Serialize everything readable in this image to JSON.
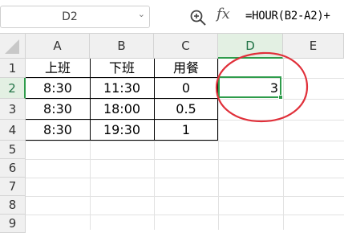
{
  "namebox": {
    "value": "D2",
    "arrow": "⌄"
  },
  "toolbar": {
    "zoom_icon": "zoom-magnifier-icon",
    "fx_label": "fx"
  },
  "formula": {
    "value": "=HOUR(B2-A2)+"
  },
  "columns": [
    "A",
    "B",
    "C",
    "D",
    "E"
  ],
  "rows": [
    "1",
    "2",
    "3",
    "4",
    "5",
    "6",
    "7",
    "8",
    "9"
  ],
  "table": {
    "headers": [
      "上班",
      "下班",
      "用餐"
    ],
    "r2": [
      "8:30",
      "11:30",
      "0"
    ],
    "r3": [
      "8:30",
      "18:00",
      "0.5"
    ],
    "r4": [
      "8:30",
      "19:30",
      "1"
    ]
  },
  "result": {
    "d2": "3"
  },
  "colors": {
    "selection_green": "#2e9c4b",
    "annotation_red": "#e0303a"
  }
}
